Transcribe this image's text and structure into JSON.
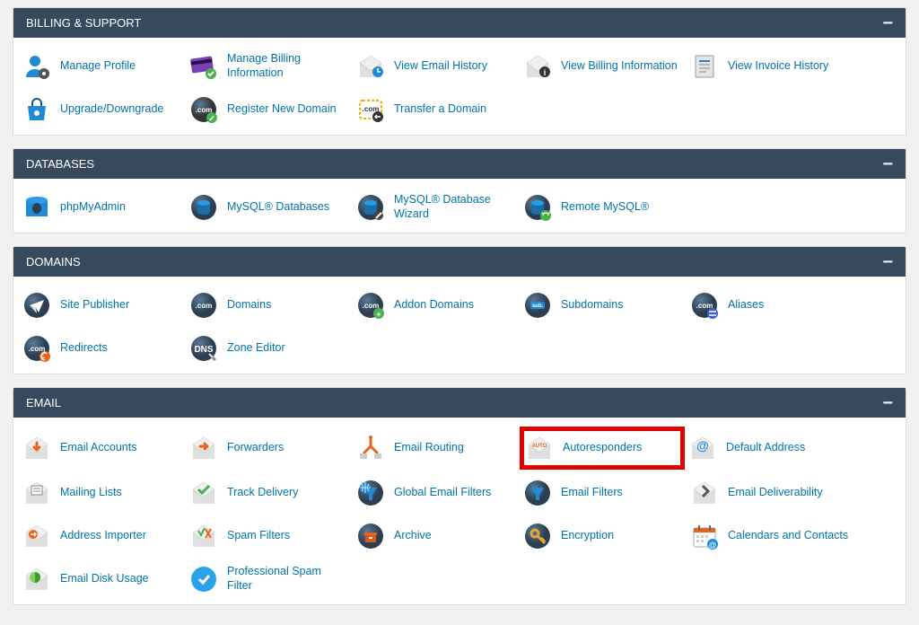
{
  "sections": [
    {
      "title": "BILLING & SUPPORT",
      "items": [
        {
          "label": "Manage Profile",
          "icon": "profile"
        },
        {
          "label": "Manage Billing Information",
          "icon": "creditcard"
        },
        {
          "label": "View Email History",
          "icon": "email-clock"
        },
        {
          "label": "View Billing Information",
          "icon": "billing-info"
        },
        {
          "label": "View Invoice History",
          "icon": "invoice"
        },
        {
          "label": "Upgrade/Downgrade",
          "icon": "bag"
        },
        {
          "label": "Register New Domain",
          "icon": "com-badge-green"
        },
        {
          "label": "Transfer a Domain",
          "icon": "com-badge-yellow"
        }
      ]
    },
    {
      "title": "DATABASES",
      "items": [
        {
          "label": "phpMyAdmin",
          "icon": "db-flat"
        },
        {
          "label": "MySQL® Databases",
          "icon": "db-sphere"
        },
        {
          "label": "MySQL® Database Wizard",
          "icon": "db-wizard"
        },
        {
          "label": "Remote MySQL®",
          "icon": "db-remote"
        }
      ]
    },
    {
      "title": "DOMAINS",
      "items": [
        {
          "label": "Site Publisher",
          "icon": "paper-plane"
        },
        {
          "label": "Domains",
          "icon": "com-sphere"
        },
        {
          "label": "Addon Domains",
          "icon": "com-addon"
        },
        {
          "label": "Subdomains",
          "icon": "sub-sphere"
        },
        {
          "label": "Aliases",
          "icon": "com-alias"
        },
        {
          "label": "Redirects",
          "icon": "com-redirect"
        },
        {
          "label": "Zone Editor",
          "icon": "dns"
        }
      ]
    },
    {
      "title": "EMAIL",
      "items": [
        {
          "label": "Email Accounts",
          "icon": "envelope-down"
        },
        {
          "label": "Forwarders",
          "icon": "envelope-fwd"
        },
        {
          "label": "Email Routing",
          "icon": "routing"
        },
        {
          "label": "Autoresponders",
          "icon": "envelope-auto",
          "highlight": true
        },
        {
          "label": "Default Address",
          "icon": "envelope-at"
        },
        {
          "label": "Mailing Lists",
          "icon": "envelope-list"
        },
        {
          "label": "Track Delivery",
          "icon": "envelope-track"
        },
        {
          "label": "Global Email Filters",
          "icon": "funnel-globe"
        },
        {
          "label": "Email Filters",
          "icon": "funnel"
        },
        {
          "label": "Email Deliverability",
          "icon": "envelope-deliver"
        },
        {
          "label": "Address Importer",
          "icon": "envelope-import"
        },
        {
          "label": "Spam Filters",
          "icon": "envelope-spam"
        },
        {
          "label": "Archive",
          "icon": "archive-sphere"
        },
        {
          "label": "Encryption",
          "icon": "key-sphere"
        },
        {
          "label": "Calendars and Contacts",
          "icon": "calendar"
        },
        {
          "label": "Email Disk Usage",
          "icon": "envelope-disk"
        },
        {
          "label": "Professional Spam Filter",
          "icon": "pro-spam"
        }
      ]
    }
  ]
}
